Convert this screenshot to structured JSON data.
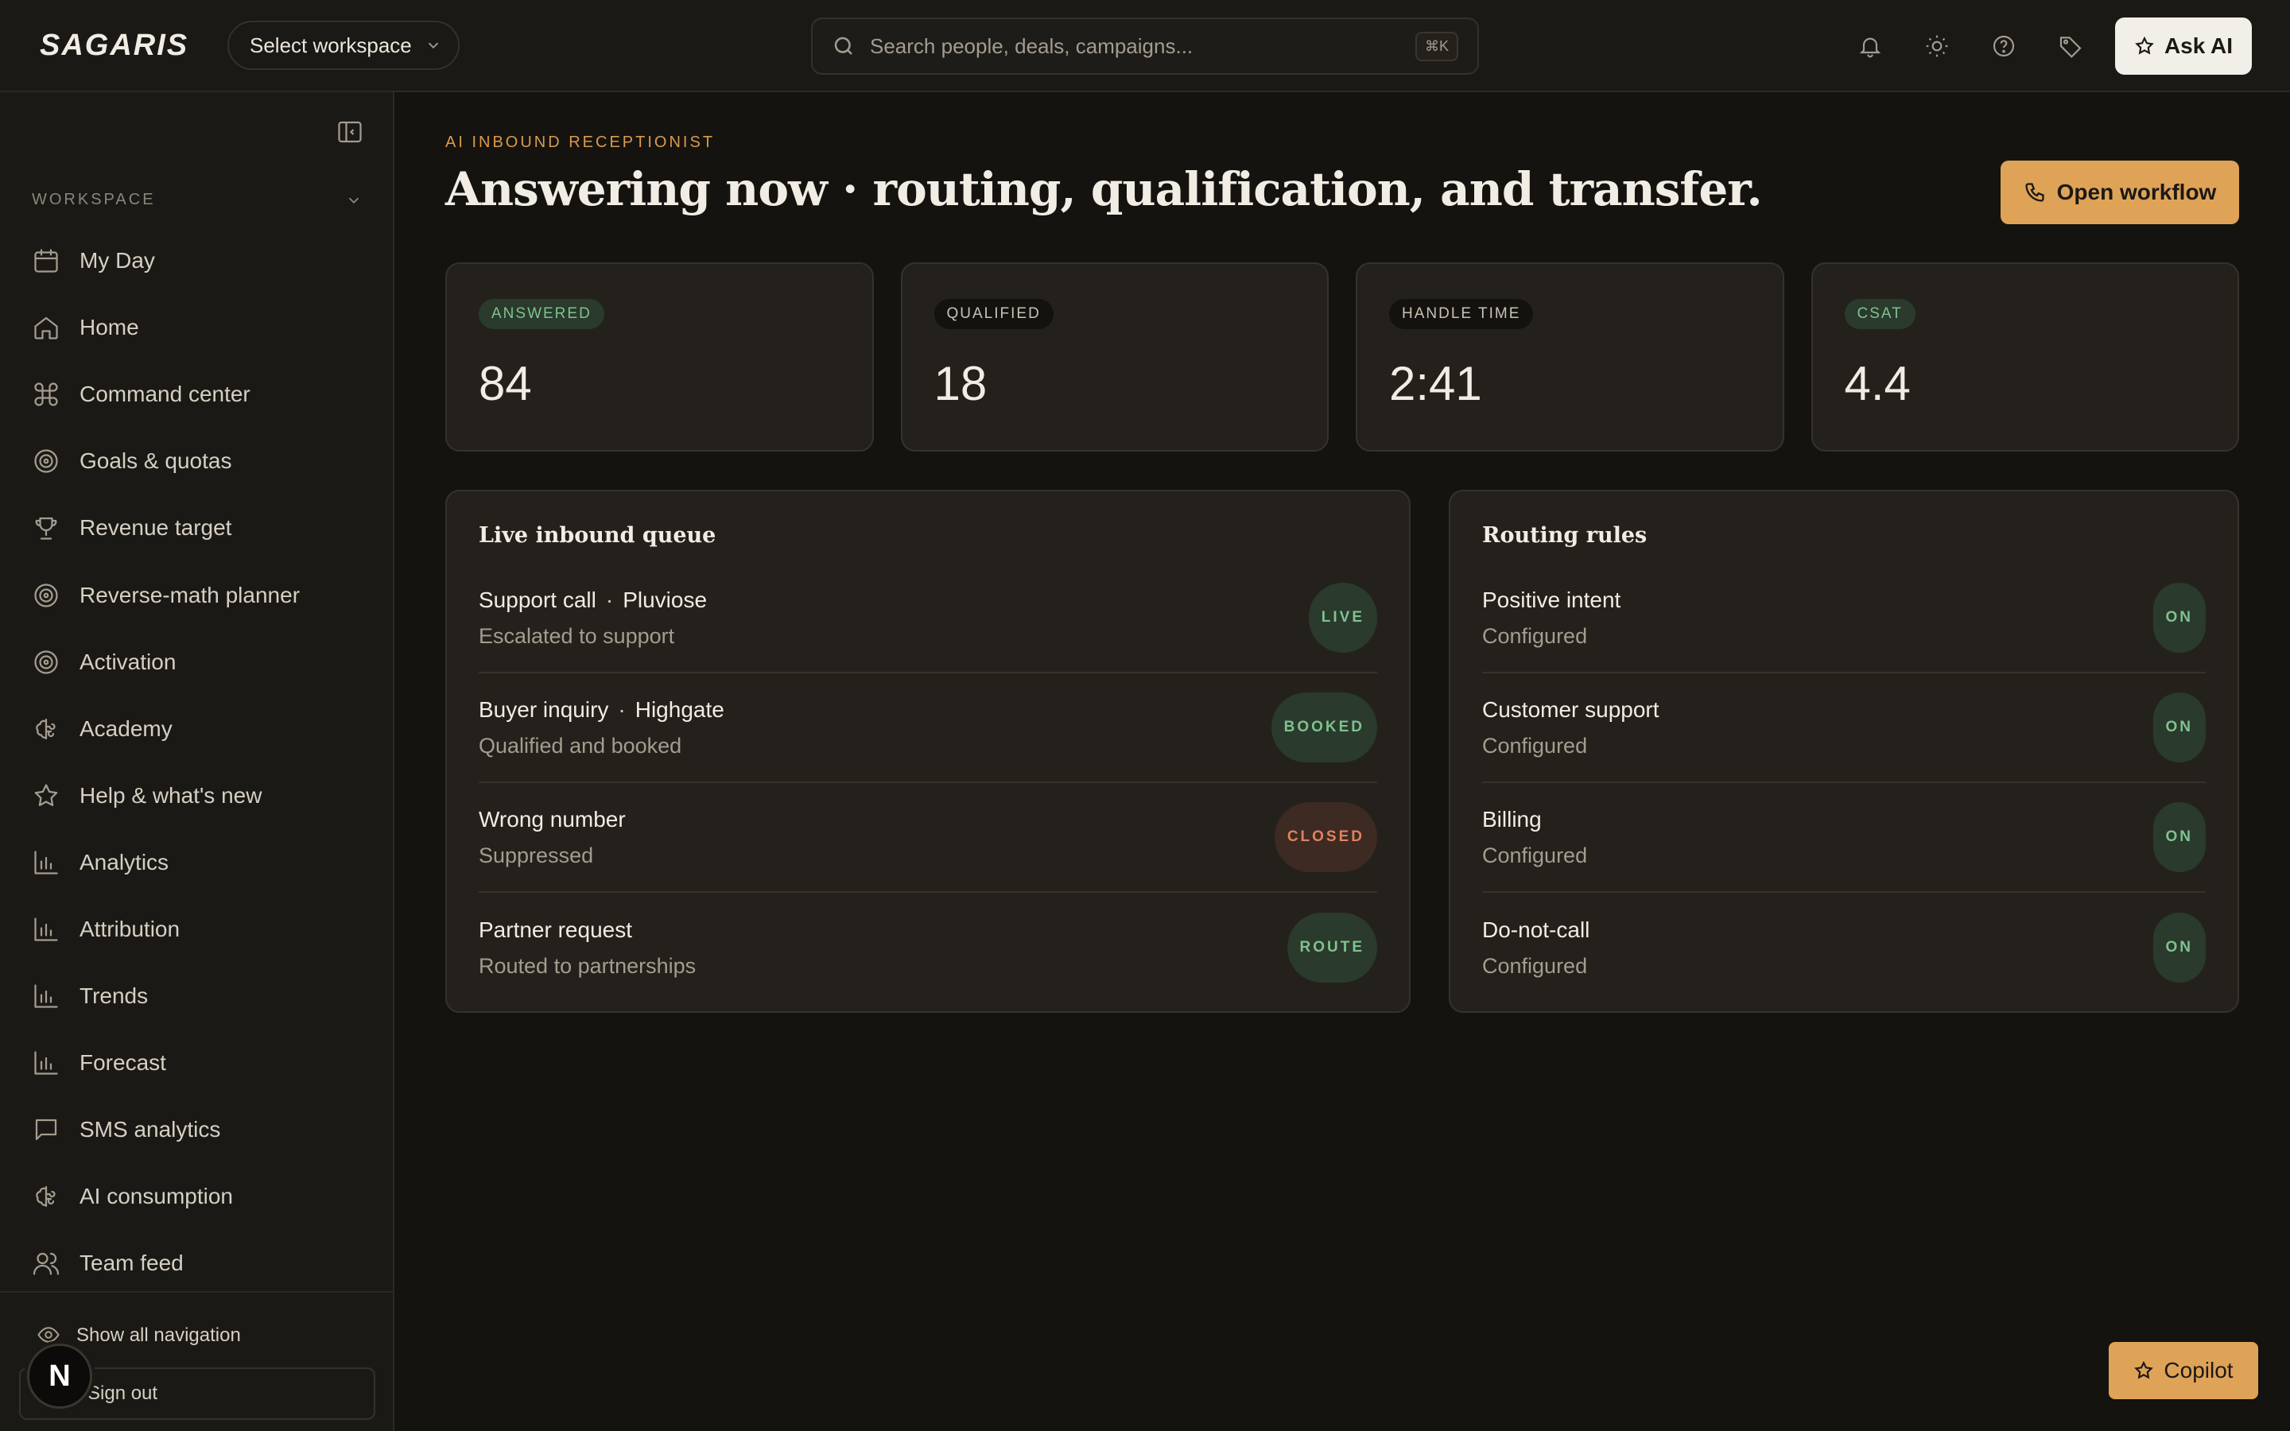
{
  "header": {
    "logo": "SAGARIS",
    "workspace_select": "Select workspace",
    "search_placeholder": "Search people, deals, campaigns...",
    "search_shortcut": "⌘K",
    "ask_ai": "Ask AI"
  },
  "sidebar": {
    "section_label": "WORKSPACE",
    "items": [
      {
        "label": "My Day",
        "icon": "calendar-icon"
      },
      {
        "label": "Home",
        "icon": "home-icon"
      },
      {
        "label": "Command center",
        "icon": "command-icon"
      },
      {
        "label": "Goals & quotas",
        "icon": "target-icon"
      },
      {
        "label": "Revenue target",
        "icon": "trophy-icon"
      },
      {
        "label": "Reverse-math planner",
        "icon": "target-icon"
      },
      {
        "label": "Activation",
        "icon": "target-icon"
      },
      {
        "label": "Academy",
        "icon": "brain-icon"
      },
      {
        "label": "Help & what's new",
        "icon": "star-icon"
      },
      {
        "label": "Analytics",
        "icon": "bar-chart-icon"
      },
      {
        "label": "Attribution",
        "icon": "bar-chart-icon"
      },
      {
        "label": "Trends",
        "icon": "bar-chart-icon"
      },
      {
        "label": "Forecast",
        "icon": "bar-chart-icon"
      },
      {
        "label": "SMS analytics",
        "icon": "message-icon"
      },
      {
        "label": "AI consumption",
        "icon": "brain-icon"
      },
      {
        "label": "Team feed",
        "icon": "users-icon"
      }
    ],
    "show_all": "Show all navigation",
    "sign_out": "Sign out",
    "avatar_letter": "N"
  },
  "main": {
    "eyebrow": "AI INBOUND RECEPTIONIST",
    "title": "Answering now · routing, qualification, and transfer.",
    "open_workflow": "Open workflow",
    "kpis": [
      {
        "label": "ANSWERED",
        "value": "84",
        "tone": "green"
      },
      {
        "label": "QUALIFIED",
        "value": "18",
        "tone": "neutral"
      },
      {
        "label": "HANDLE TIME",
        "value": "2:41",
        "tone": "neutral"
      },
      {
        "label": "CSAT",
        "value": "4.4",
        "tone": "green"
      }
    ],
    "queue": {
      "title": "Live inbound queue",
      "rows": [
        {
          "main": "Support call",
          "company": "Pluviose",
          "sub": "Escalated to support",
          "status": "LIVE",
          "tone": "green"
        },
        {
          "main": "Buyer inquiry",
          "company": "Highgate",
          "sub": "Qualified and booked",
          "status": "BOOKED",
          "tone": "green"
        },
        {
          "main": "Wrong number",
          "company": "",
          "sub": "Suppressed",
          "status": "CLOSED",
          "tone": "red"
        },
        {
          "main": "Partner request",
          "company": "",
          "sub": "Routed to partnerships",
          "status": "ROUTE",
          "tone": "green"
        }
      ]
    },
    "routing": {
      "title": "Routing rules",
      "rows": [
        {
          "main": "Positive intent",
          "sub": "Configured",
          "status": "ON"
        },
        {
          "main": "Customer support",
          "sub": "Configured",
          "status": "ON"
        },
        {
          "main": "Billing",
          "sub": "Configured",
          "status": "ON"
        },
        {
          "main": "Do-not-call",
          "sub": "Configured",
          "status": "ON"
        }
      ]
    }
  },
  "copilot": "Copilot",
  "colors": {
    "accent": "#dfa357",
    "green": "#7fc28f",
    "red": "#e0825e",
    "bg": "#15130f"
  }
}
